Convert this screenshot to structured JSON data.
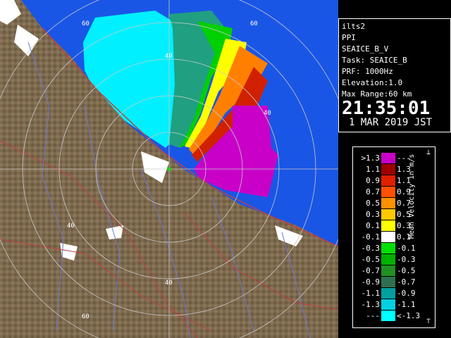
{
  "map": {
    "range_labels": [
      "40",
      "40",
      "40",
      "40",
      "60",
      "60",
      "60"
    ],
    "colors": {
      "sea": "#1a56e6",
      "land": "#7d6a4f",
      "river": "#6a7ad8",
      "road": "#c04040",
      "snow": "#ffffff"
    }
  },
  "info": {
    "site": "ilts2",
    "product": "PPI",
    "product_name": "SEAICE_B_V",
    "task": "Task: SEAICE_B",
    "prf": "PRF: 1000Hz",
    "elevation": "Elevation:1.0",
    "max_range": "Max Range:60 km",
    "time": "21:35:01",
    "date": "1 MAR 2019 JST"
  },
  "legend": {
    "unit": "Mean Velocity in m/s",
    "rows": [
      {
        "left": ">1.3",
        "right": "---",
        "color": "#c800c8"
      },
      {
        "left": "1.1",
        "right": "1.3",
        "color": "#a00000"
      },
      {
        "left": "0.9",
        "right": "1.1",
        "color": "#e02000"
      },
      {
        "left": "0.7",
        "right": "0.9",
        "color": "#ff5000"
      },
      {
        "left": "0.5",
        "right": "0.7",
        "color": "#ff9000"
      },
      {
        "left": "0.3",
        "right": "0.5",
        "color": "#ffc800"
      },
      {
        "left": "0.1",
        "right": "0.3",
        "color": "#ffff00"
      },
      {
        "left": "-0.1",
        "right": "0.1",
        "color": "#ffffff"
      },
      {
        "left": "-0.3",
        "right": "-0.1",
        "color": "#00e000"
      },
      {
        "left": "-0.5",
        "right": "-0.3",
        "color": "#00b000"
      },
      {
        "left": "-0.7",
        "right": "-0.5",
        "color": "#209020"
      },
      {
        "left": "-0.9",
        "right": "-0.7",
        "color": "#307050"
      },
      {
        "left": "-1.1",
        "right": "-0.9",
        "color": "#00a0a0"
      },
      {
        "left": "-1.3",
        "right": "-1.1",
        "color": "#00d0e0"
      },
      {
        "left": "---",
        "right": "<-1.3",
        "color": "#00ffff"
      }
    ]
  }
}
